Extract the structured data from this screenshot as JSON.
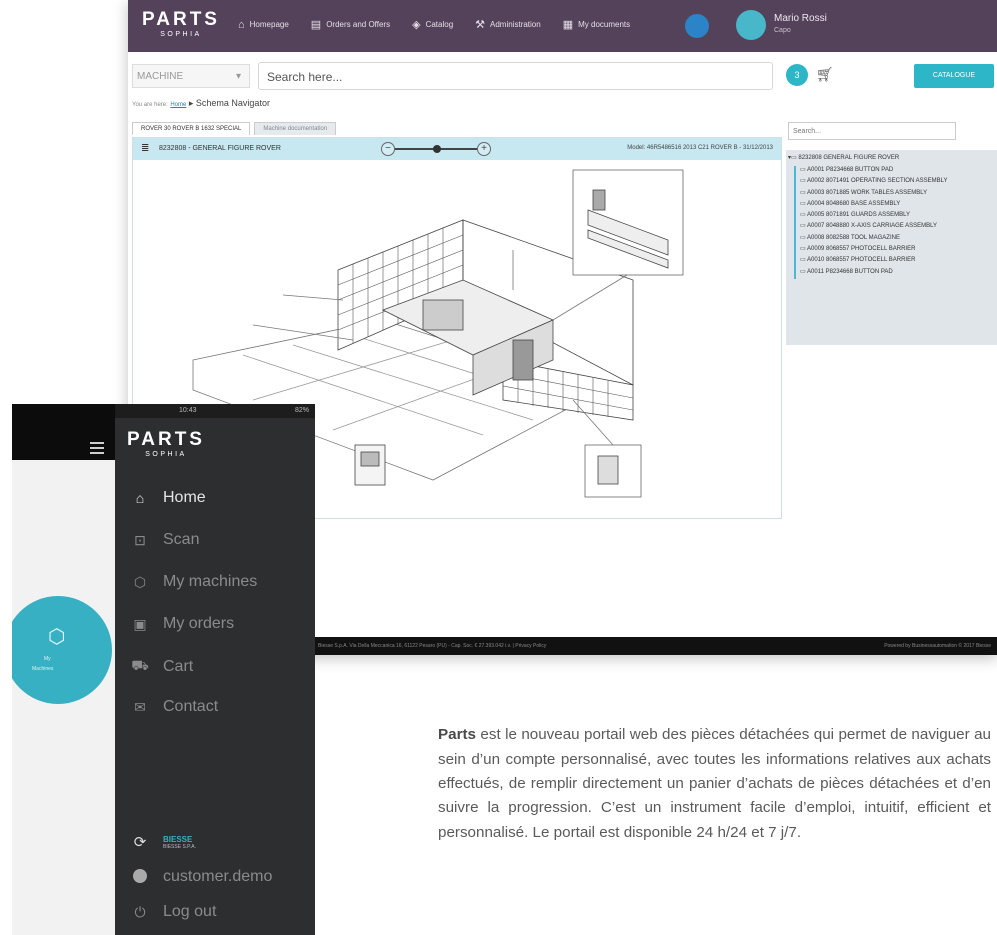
{
  "desktop": {
    "logo": {
      "word": "PARTS",
      "sub": "SOPHIA"
    },
    "nav": [
      {
        "icon": "home-icon",
        "label": "Homepage"
      },
      {
        "icon": "orders-icon",
        "label": "Orders and Offers"
      },
      {
        "icon": "catalog-icon",
        "label": "Catalog"
      },
      {
        "icon": "wrench-icon",
        "label": "Administration"
      },
      {
        "icon": "documents-icon",
        "label": "My documents"
      }
    ],
    "user": {
      "name": "Mario Rossi",
      "role": "Capo"
    },
    "machine_select": {
      "value": "MACHINE"
    },
    "search": {
      "placeholder": "Search here..."
    },
    "cart_badge": "3",
    "teal_button": "CATALOGUE",
    "breadcrumb": {
      "prefix": "You are here:",
      "home": "Home",
      "current": "Schema Navigator"
    },
    "tabs": [
      "ROVER 30 ROVER B 1632 SPECIAL",
      "Machine documentation"
    ],
    "panel": {
      "title": "8232808 - GENERAL FIGURE ROVER",
      "model": "Model: 46R5486516 2013 C21 ROVER B - 31/12/2013"
    },
    "tree": {
      "search_placeholder": "Search...",
      "root": "8232808 GENERAL FIGURE ROVER",
      "items": [
        "A0001 P8234668 BUTTON PAD",
        "A0002 8071491 OPERATING SECTION ASSEMBLY",
        "A0003 8071885 WORK TABLES ASSEMBLY",
        "A0004 8048680 BASE ASSEMBLY",
        "A0005 8071891 GUARDS ASSEMBLY",
        "A0007 8048880 X-AXIS CARRIAGE ASSEMBLY",
        "A0008 8082588 TOOL MAGAZINE",
        "A0009 8068557 PHOTOCELL BARRIER",
        "A0010 8068557 PHOTOCELL BARRIER",
        "A0011 P8234668 BUTTON PAD"
      ]
    },
    "footer": {
      "left": "Biesse S.p.A. Via Della Meccanica 16, 61122 Pesaro (PU) - Cap. Soc. € 27.393.042 i.v. | Privacy Policy",
      "right": "Powered by Businessautomation © 2017 Biesse"
    }
  },
  "mobile": {
    "status": {
      "time": "10:43",
      "battery": "82%"
    },
    "left_status": "",
    "logo": {
      "word": "PARTS",
      "sub": "SOPHIA"
    },
    "menu": [
      {
        "icon": "home-icon",
        "label": "Home"
      },
      {
        "icon": "scan-icon",
        "label": "Scan"
      },
      {
        "icon": "machine-icon",
        "label": "My machines"
      },
      {
        "icon": "orders-icon",
        "label": "My orders"
      },
      {
        "icon": "cart-icon",
        "label": "Cart"
      },
      {
        "icon": "mail-icon",
        "label": "Contact"
      }
    ],
    "company": {
      "name": "BIESSE",
      "sub": "BIESSE S.P.A."
    },
    "account": "customer.demo",
    "logout": "Log out",
    "circle": {
      "line1": "My",
      "line2": "Machines"
    }
  },
  "description": {
    "lead": "Parts",
    "body": " est le nouveau portail web des pièces détachées qui permet de naviguer au sein d’un compte personnalisé, avec toutes les informations relatives aux achats effectués, de remplir directement un panier d’achats de pièces détachées et d’en suivre la progression. C’est un instrument facile d’emploi, intuitif, efficient et personnalisé. Le portail est disponible 24 h/24 et 7 j/7."
  }
}
